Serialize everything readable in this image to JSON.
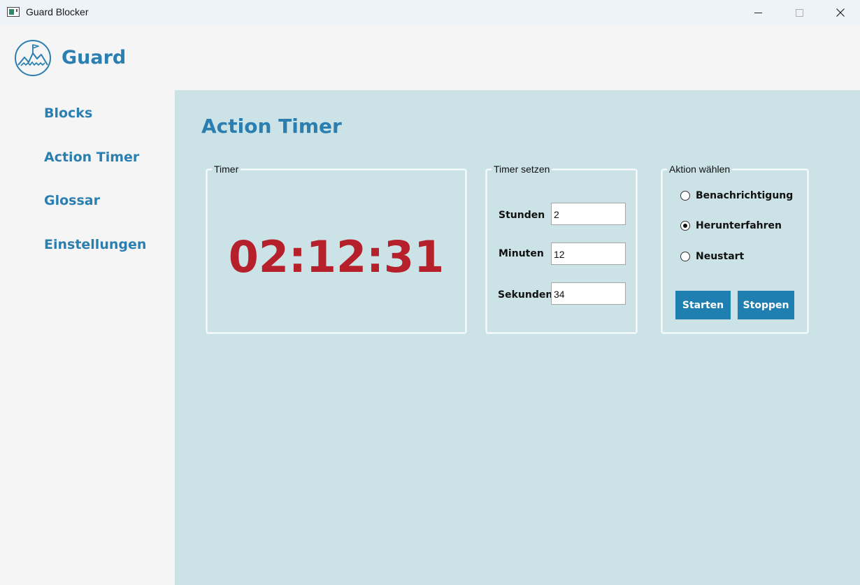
{
  "window": {
    "title": "Guard Blocker",
    "minimize_icon": "minimize-icon",
    "maximize_icon": "maximize-icon",
    "close_icon": "close-icon"
  },
  "brand": {
    "name": "Guard",
    "logo_icon": "mountain-flag-logo"
  },
  "sidebar": {
    "items": [
      {
        "label": "Blocks"
      },
      {
        "label": "Action Timer"
      },
      {
        "label": "Glossar"
      },
      {
        "label": "Einstellungen"
      }
    ]
  },
  "main": {
    "title": "Action Timer",
    "timer_group": {
      "label": "Timer",
      "countdown": "02:12:31"
    },
    "set_group": {
      "label": "Timer setzen",
      "fields": [
        {
          "label": "Stunden",
          "value": "2"
        },
        {
          "label": "Minuten",
          "value": "12"
        },
        {
          "label": "Sekunden",
          "value": "34"
        }
      ]
    },
    "action_group": {
      "label": "Aktion wählen",
      "options": [
        {
          "label": "Benachrichtigung",
          "checked": false
        },
        {
          "label": "Herunterfahren",
          "checked": true
        },
        {
          "label": "Neustart",
          "checked": false
        }
      ],
      "start_label": "Starten",
      "stop_label": "Stoppen"
    }
  },
  "colors": {
    "accent": "#2a7fb0",
    "button": "#1f7fb0",
    "countdown": "#b5202a",
    "panel_bg": "#cbe2e7",
    "sidebar_bg": "#f5f5f5"
  }
}
